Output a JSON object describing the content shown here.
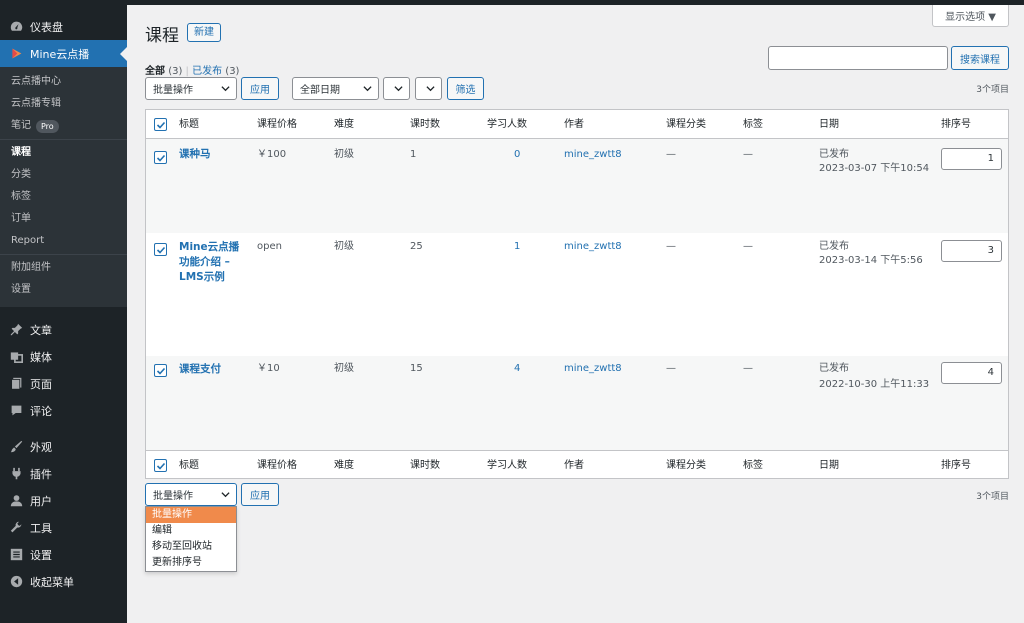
{
  "sidebar": {
    "dashboard": "仪表盘",
    "mine": "Mine云点播",
    "sub": {
      "center": "云点播中心",
      "album": "云点播专辑",
      "notes": "笔记",
      "pro": "Pro",
      "courses": "课程",
      "category": "分类",
      "tags": "标签",
      "orders": "订单",
      "report": "Report",
      "addons": "附加组件",
      "settings": "设置"
    },
    "posts": "文章",
    "media": "媒体",
    "pages": "页面",
    "comments": "评论",
    "appearance": "外观",
    "plugins": "插件",
    "users": "用户",
    "tools": "工具",
    "settings": "设置",
    "collapse": "收起菜单"
  },
  "header": {
    "screen_options": "显示选项 ▼",
    "title": "课程",
    "add_new": "新建"
  },
  "filters": {
    "all": "全部",
    "all_count": "(3)",
    "published": "已发布",
    "published_count": "(3)",
    "search_button": "搜索课程",
    "bulk_action": "批量操作",
    "apply": "应用",
    "all_dates": "全部日期",
    "filter": "筛选",
    "items_count": "3个项目"
  },
  "table": {
    "columns": [
      "标题",
      "课程价格",
      "难度",
      "课时数",
      "学习人数",
      "作者",
      "课程分类",
      "标签",
      "日期",
      "排序号"
    ],
    "rows": [
      {
        "title": "课种马",
        "price": "￥100",
        "level": "初级",
        "lessons": "1",
        "students": "0",
        "author": "mine_zwtt8",
        "category": "—",
        "tags": "—",
        "status": "已发布",
        "date": "2023-03-07 下午10:54",
        "order": "1"
      },
      {
        "title": "Mine云点播功能介绍 – LMS示例",
        "price": "open",
        "level": "初级",
        "lessons": "25",
        "students": "1",
        "author": "mine_zwtt8",
        "category": "—",
        "tags": "—",
        "status": "已发布",
        "date": "2023-03-14 下午5:56",
        "order": "3"
      },
      {
        "title": "课程支付",
        "price": "￥10",
        "level": "初级",
        "lessons": "15",
        "students": "4",
        "author": "mine_zwtt8",
        "category": "—",
        "tags": "—",
        "status": "已发布",
        "date": "2022-10-30 上午11:33",
        "order": "4"
      }
    ]
  },
  "dropdown": {
    "options": [
      "批量操作",
      "编辑",
      "移动至回收站",
      "更新排序号"
    ]
  }
}
